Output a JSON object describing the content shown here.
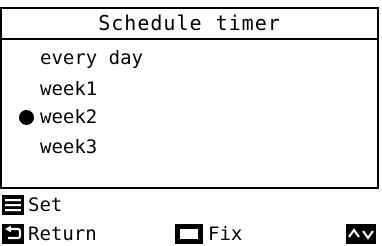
{
  "title": "Schedule timer",
  "schedule_options": [
    {
      "label": "every day",
      "selected": false
    },
    {
      "label": "week1",
      "selected": false
    },
    {
      "label": "week2",
      "selected": true
    },
    {
      "label": "week3",
      "selected": false
    }
  ],
  "footer": {
    "set": {
      "icon": "menu-icon",
      "label": "Set"
    },
    "return": {
      "icon": "return-icon",
      "label": "Return"
    },
    "fix": {
      "icon": "square-button-icon",
      "label": "Fix"
    },
    "navigate": {
      "icon": "up-down-arrows-icon"
    }
  }
}
